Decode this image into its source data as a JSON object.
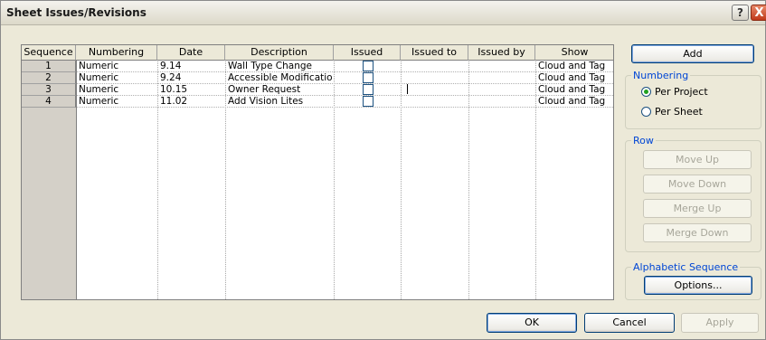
{
  "window": {
    "title": "Sheet Issues/Revisions"
  },
  "titlebar_buttons": {
    "help": "?",
    "close": "X"
  },
  "table": {
    "headers": [
      "Sequence",
      "Numbering",
      "Date",
      "Description",
      "Issued",
      "Issued to",
      "Issued by",
      "Show"
    ],
    "rows": [
      {
        "seq": "1",
        "numbering": "Numeric",
        "date": "9.14",
        "description": "Wall Type Change",
        "issued": false,
        "issued_to": "",
        "issued_by": "",
        "show": "Cloud and Tag"
      },
      {
        "seq": "2",
        "numbering": "Numeric",
        "date": "9.24",
        "description": "Accessible Modifications",
        "issued": false,
        "issued_to": "",
        "issued_by": "",
        "show": "Cloud and Tag"
      },
      {
        "seq": "3",
        "numbering": "Numeric",
        "date": "10.15",
        "description": "Owner Request",
        "issued": false,
        "issued_to": "",
        "issued_by": "",
        "show": "Cloud and Tag"
      },
      {
        "seq": "4",
        "numbering": "Numeric",
        "date": "11.02",
        "description": "Add Vision Lites",
        "issued": false,
        "issued_to": "",
        "issued_by": "",
        "show": "Cloud and Tag"
      }
    ]
  },
  "side": {
    "add_label": "Add",
    "numbering": {
      "legend": "Numbering",
      "per_project": "Per Project",
      "per_sheet": "Per Sheet",
      "selected": "Per Project"
    },
    "row": {
      "legend": "Row",
      "move_up": "Move Up",
      "move_down": "Move Down",
      "merge_up": "Merge Up",
      "merge_down": "Merge Down"
    },
    "alpha": {
      "legend": "Alphabetic Sequence",
      "options": "Options..."
    }
  },
  "footer": {
    "ok": "OK",
    "cancel": "Cancel",
    "apply": "Apply"
  }
}
